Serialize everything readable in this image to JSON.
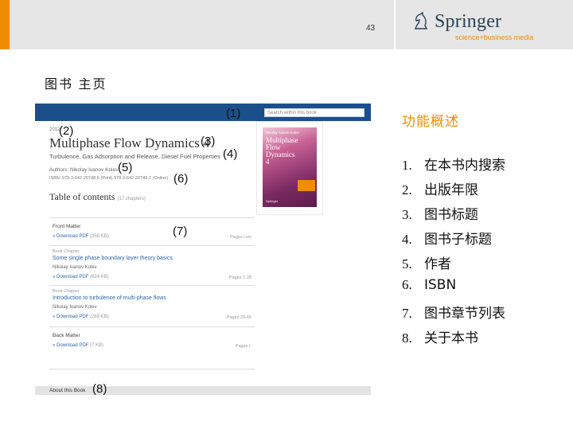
{
  "header": {
    "page_number": "43",
    "brand": {
      "name": "Springer",
      "tagline": "science+business media",
      "primary_color": "#28425b",
      "accent_color": "#f08c00"
    }
  },
  "section_title": "图书 主页",
  "screenshot": {
    "search_placeholder": "Search within this book",
    "year": "2012",
    "book_title": "Multiphase Flow Dynamics 4",
    "subtitle": "Turbulence, Gas Adsorption and Release, Diesel Fuel Properties",
    "authors": "Authors: Nikolay Ivanov Kolev",
    "isbn": "ISBN: 978-3-642-20748-5 (Print) 978-3-642-20749-2 (Online)",
    "toc_heading": "Table of contents",
    "toc_count": "(17 chapters)",
    "entries": [
      {
        "type": "front",
        "title": "Front Matter",
        "download": "» Download PDF",
        "size": "(358 KB)",
        "pages": "Pages i-xiv"
      },
      {
        "type": "chapter",
        "label": "Book Chapter",
        "title": "Some single phase boundary layer theory basics",
        "author": "Nikolay Ivanov Kolev",
        "download": "» Download PDF",
        "size": "(824 KB)",
        "pages": "Pages 1-28"
      },
      {
        "type": "chapter",
        "label": "Book Chapter",
        "title": "Introduction to turbulence of multi-phase flows",
        "author": "Nikolay Ivanov Kolev",
        "download": "» Download PDF",
        "size": "(269 KB)",
        "pages": "Pages 29-65"
      },
      {
        "type": "back",
        "title": "Back Matter",
        "download": "» Download PDF",
        "size": "(7 KB)",
        "pages": "Pages i-"
      }
    ],
    "about": "About this Book",
    "cover": {
      "author": "Nikolay Ivanov Kolev",
      "title_lines": [
        "Multiphase",
        "Flow",
        "Dynamics",
        "4"
      ],
      "publisher": "Springer"
    }
  },
  "callouts": [
    "(1)",
    "(2)",
    "(3)",
    "(4)",
    "(5)",
    "(6)",
    "(7)",
    "(8)"
  ],
  "panel": {
    "title": "功能概述",
    "items": [
      {
        "num": "1.",
        "text": "在本书内搜索"
      },
      {
        "num": "2.",
        "text": "出版年限"
      },
      {
        "num": "3.",
        "text": "图书标题"
      },
      {
        "num": "4.",
        "text": "图书子标题"
      },
      {
        "num": "5.",
        "text": "作者"
      },
      {
        "num": "6.",
        "text": "ISBN"
      },
      {
        "num": "7.",
        "text": "图书章节列表"
      },
      {
        "num": "8.",
        "text": "关于本书"
      }
    ]
  }
}
